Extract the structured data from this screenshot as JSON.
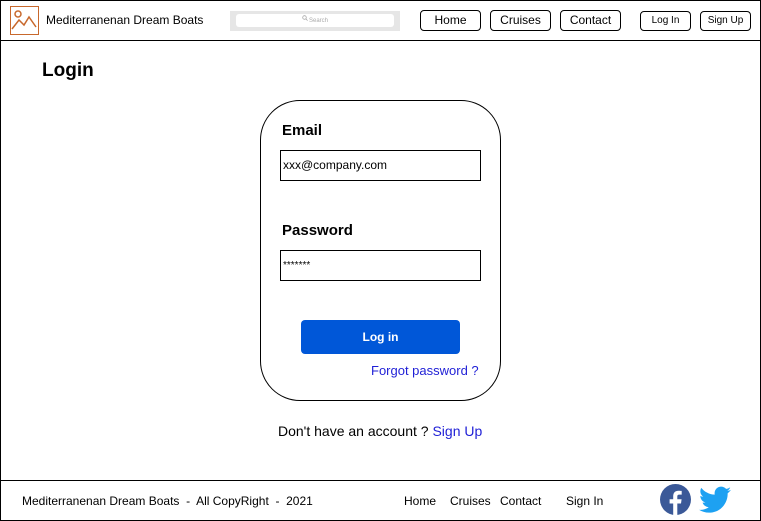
{
  "header": {
    "brand": "Mediterranenan Dream Boats",
    "search_placeholder": "Search",
    "nav": [
      "Home",
      "Cruises",
      "Contact"
    ],
    "login_label": "Log In",
    "signup_label": "Sign Up"
  },
  "main": {
    "title": "Login",
    "email_label": "Email",
    "email_value": "xxx@company.com",
    "password_label": "Password",
    "password_value": "*******",
    "login_button": "Log in",
    "forgot_link": "Forgot password ?",
    "no_account_text": "Don't have an account ?",
    "signup_link": "Sign Up"
  },
  "footer": {
    "brand_line": "Mediterranenan Dream Boats  -  All CopyRight  -  2021",
    "nav": [
      "Home",
      "Cruises",
      "Contact",
      "Sign In"
    ],
    "social_icons": [
      "facebook-icon",
      "twitter-icon"
    ]
  },
  "colors": {
    "accent": "#0057d8",
    "link": "#1f1fd6",
    "logo": "#c8682c",
    "facebook": "#3b5998",
    "twitter": "#1da1f2"
  }
}
